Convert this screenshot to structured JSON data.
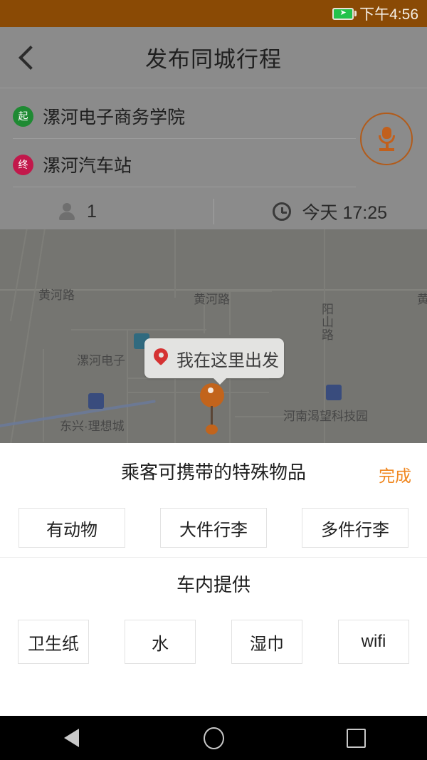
{
  "statusbar": {
    "time": "下午4:56",
    "battery_icon": "battery-charging-icon",
    "background_color": "#8a4a05"
  },
  "appbar": {
    "back_icon": "chevron-left-icon",
    "title": "发布同城行程",
    "background_color": "#8b8b8b"
  },
  "form": {
    "start": {
      "badge": "起",
      "badge_color": "#1f8a33",
      "place": "漯河电子商务学院"
    },
    "end": {
      "badge": "终",
      "badge_color": "#c2184b",
      "place": "漯河汽车站"
    },
    "mic_icon": "microphone-icon",
    "mic_color": "#c2601c",
    "seats": {
      "icon": "person-icon",
      "value": "1"
    },
    "time": {
      "icon": "clock-icon",
      "value": "今天 17:25"
    }
  },
  "map": {
    "callout": {
      "pin_icon": "map-pin-icon",
      "text": "我在这里出发"
    },
    "marker_icon": "location-marker-icon",
    "marker_color": "#c2641c",
    "labels": [
      {
        "text": "黄河路"
      },
      {
        "text": "黄河路"
      },
      {
        "text": "黄"
      },
      {
        "text": "阳山路"
      },
      {
        "text": "漯河电子"
      },
      {
        "text": "东兴·理想城"
      },
      {
        "text": "河南渴望科技园"
      }
    ],
    "poi_icons": [
      "school-icon",
      "home-icon",
      "building-icon"
    ]
  },
  "sheet": {
    "title": "乘客可携带的特殊物品",
    "done_label": "完成",
    "done_color": "#f0871f",
    "items": [
      {
        "label": "有动物"
      },
      {
        "label": "大件行李"
      },
      {
        "label": "多件行李"
      }
    ],
    "subtitle": "车内提供",
    "amenities": [
      {
        "label": "卫生纸"
      },
      {
        "label": "水"
      },
      {
        "label": "湿巾"
      },
      {
        "label": "wifi"
      }
    ]
  },
  "navbar": {
    "back_icon": "nav-back-icon",
    "home_icon": "nav-home-icon",
    "recents_icon": "nav-recents-icon"
  }
}
